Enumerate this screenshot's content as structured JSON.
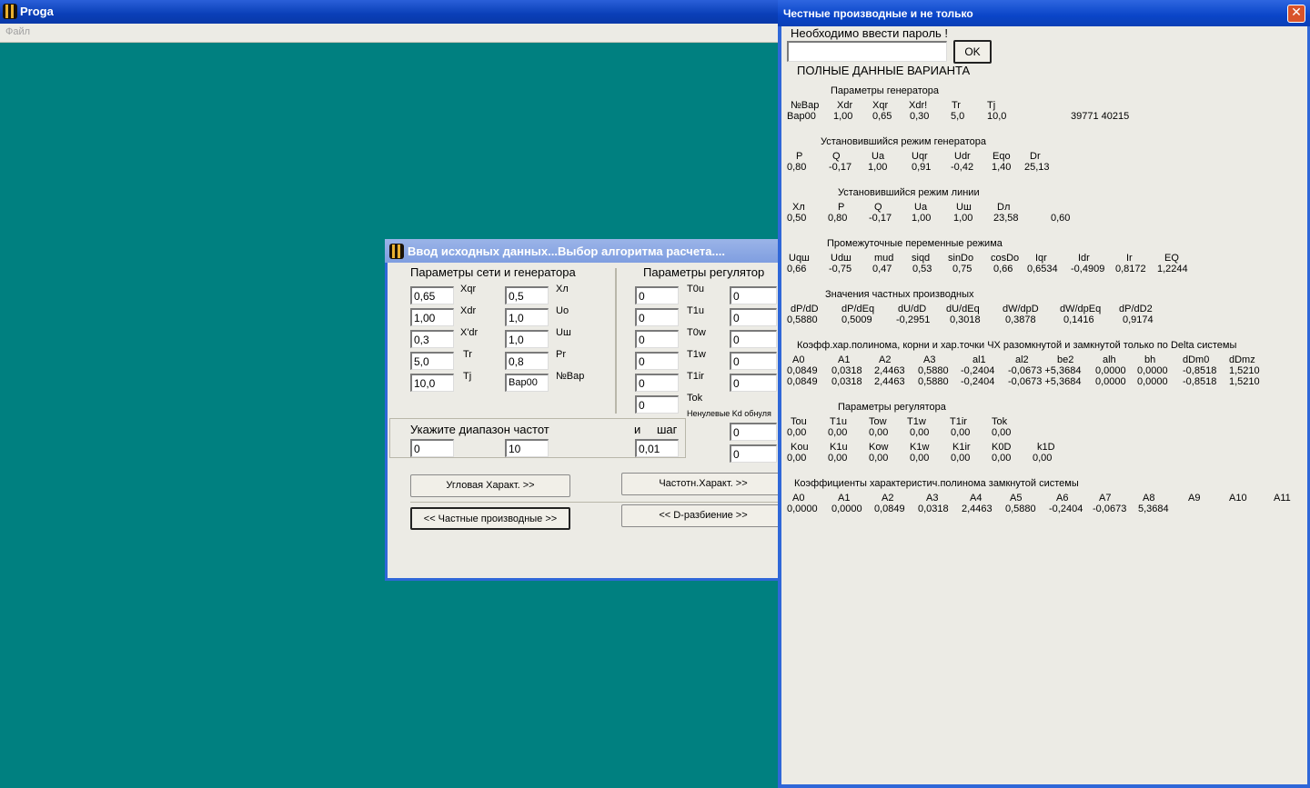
{
  "main_window": {
    "title": "Proga",
    "menu_file": "Файл"
  },
  "dialog": {
    "title": "Ввод исходных данных...Выбор алгоритма расчета....",
    "group_network": "Параметры сети и генератора",
    "group_regulator": "Параметры регулятор",
    "gen_fields": [
      {
        "label": "Xqr",
        "value": "0,65"
      },
      {
        "label": "Xdr",
        "value": "1,00"
      },
      {
        "label": "X'dr",
        "value": "0,3"
      },
      {
        "label": "Tr",
        "value": "5,0"
      },
      {
        "label": "Tj",
        "value": "10,0"
      }
    ],
    "net_fields": [
      {
        "label": "Xл",
        "value": "0,5"
      },
      {
        "label": "Uo",
        "value": "1,0"
      },
      {
        "label": "Uш",
        "value": "1,0"
      },
      {
        "label": "Pr",
        "value": "0,8"
      },
      {
        "label": "№Вар",
        "value": "Вар00"
      }
    ],
    "reg_fields": [
      {
        "label": "T0u",
        "value": "0",
        "value2": "0"
      },
      {
        "label": "T1u",
        "value": "0",
        "value2": "0"
      },
      {
        "label": "T0w",
        "value": "0",
        "value2": "0"
      },
      {
        "label": "T1w",
        "value": "0",
        "value2": "0"
      },
      {
        "label": "T1ir",
        "value": "0",
        "value2": "0"
      },
      {
        "label": "Tok",
        "value": "0"
      }
    ],
    "nonzero_note": "Ненулевые Kd обнуля",
    "extra_fields": [
      "0",
      "0"
    ],
    "freq_label": "Укажите диапазон  частот",
    "step_and": "и",
    "step_label": "шаг",
    "freq_from": "0",
    "freq_to": "10",
    "freq_step": "0,01",
    "btn_angle": "Угловая Характ. >>",
    "btn_freq": "Частотн.Характ. >>",
    "btn_partial": "<< Частные производные >>",
    "btn_d": "<< D-разбиение >>"
  },
  "results": {
    "title": "Честные производные и не только",
    "close": "✕",
    "password_prompt": "Необходимо ввести пароль !",
    "password_value": "",
    "ok": "OK",
    "full_data": "ПОЛНЫЕ ДАННЫЕ ВАРИАНТА",
    "s1_title": "Параметры генератора",
    "s1_h": [
      "№Вар",
      "Xdr",
      "Xqr",
      "Xdr!",
      "Tr",
      "Tj"
    ],
    "s1_v": [
      "Вар00",
      "1,00",
      "0,65",
      "0,30",
      "5,0",
      "10,0",
      "39771 40215"
    ],
    "s2_title": "Установившийся режим генератора",
    "s2_h": [
      "P",
      "Q",
      "Ua",
      "Uqr",
      "Udr",
      "Eqo",
      "Dr"
    ],
    "s2_v": [
      "0,80",
      "-0,17",
      "1,00",
      "0,91",
      "-0,42",
      "1,40",
      "25,13"
    ],
    "s3_title": "Установившийся режим линии",
    "s3_h": [
      "Xл",
      "P",
      "Q",
      "Ua",
      "Uш",
      "Dл"
    ],
    "s3_v": [
      "0,50",
      "0,80",
      "-0,17",
      "1,00",
      "1,00",
      "23,58",
      "0,60"
    ],
    "s4_title": "Промежуточные переменные режима",
    "s4_h": [
      "Uqш",
      "Udш",
      "mud",
      "siqd",
      "sinDo",
      "cosDo",
      "Iqr",
      "Idr",
      "Ir",
      "EQ"
    ],
    "s4_v": [
      "0,66",
      "-0,75",
      "0,47",
      "0,53",
      "0,75",
      "0,66",
      "0,6534",
      "-0,4909",
      "0,8172",
      "1,2244"
    ],
    "s5_title": "Значения частных производных",
    "s5_h": [
      "dP/dD",
      "dP/dEq",
      "dU/dD",
      "dU/dEq",
      "dW/dpD",
      "dW/dpEq",
      "dP/dD2"
    ],
    "s5_v": [
      "0,5880",
      "0,5009",
      "-0,2951",
      "0,3018",
      "0,3878",
      "0,1416",
      "0,9174"
    ],
    "s6_title": "Коэфф.хар.полинома, корни  и хар.точки ЧХ разомкнутой и замкнутой только по Delta системы",
    "s6_h": [
      "A0",
      "A1",
      "A2",
      "A3",
      "al1",
      "al2",
      "be2",
      "alh",
      "bh",
      "dDm0",
      "dDmz"
    ],
    "s6_v1": [
      "0,0849",
      "0,0318",
      "2,4463",
      "0,5880",
      "-0,2404",
      "-0,0673 +5,3684",
      "0,0000",
      "0,0000",
      "-0,8518",
      "1,5210"
    ],
    "s6_v2": [
      "0,0849",
      "0,0318",
      "2,4463",
      "0,5880",
      "-0,2404",
      "-0,0673 +5,3684",
      "0,0000",
      "0,0000",
      "-0,8518",
      "1,5210"
    ],
    "s7_title": "Параметры регулятора",
    "s7_h1": [
      "Tou",
      "T1u",
      "Tow",
      "T1w",
      "T1ir",
      "Tok"
    ],
    "s7_v1": [
      "0,00",
      "0,00",
      "0,00",
      "0,00",
      "0,00",
      "0,00"
    ],
    "s7_h2": [
      "Kou",
      "K1u",
      "Kow",
      "K1w",
      "K1ir",
      "K0D",
      "k1D"
    ],
    "s7_v2": [
      "0,00",
      "0,00",
      "0,00",
      "0,00",
      "0,00",
      "0,00",
      "0,00"
    ],
    "s8_title": "Коэффициенты характеристич.полинома замкнутой системы",
    "s8_h": [
      "A0",
      "A1",
      "A2",
      "A3",
      "A4",
      "A5",
      "A6",
      "A7",
      "A8",
      "A9",
      "A10",
      "A11"
    ],
    "s8_v": [
      "0,0000",
      "0,0000",
      "0,0849",
      "0,0318",
      "2,4463",
      "0,5880",
      "-0,2404",
      "-0,0673",
      "5,3684"
    ]
  }
}
